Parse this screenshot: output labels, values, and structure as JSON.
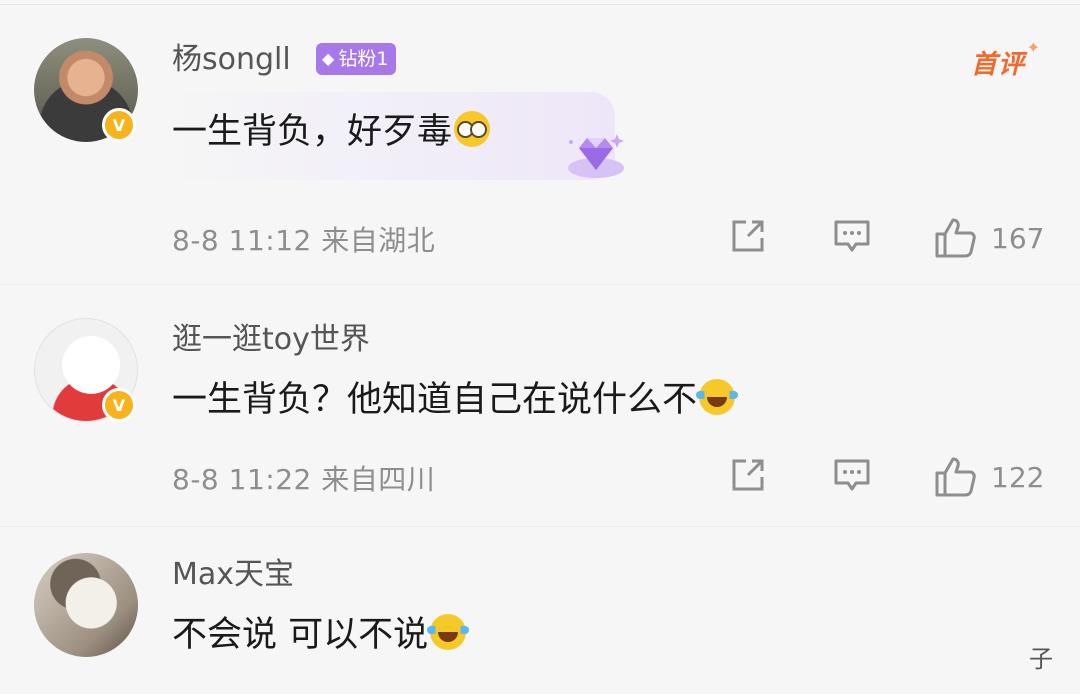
{
  "comments": [
    {
      "username": "杨songll",
      "fan_badge": "钻粉1",
      "first_tag": "首评",
      "text": "一生背负，好歹毒",
      "emoji": "glasses-emoji",
      "date": "8-8 11:12",
      "location": "来自湖北",
      "likes": "167",
      "verified": true
    },
    {
      "username": "逛一逛toy世界",
      "text": "一生背负？他知道自己在说什么不",
      "emoji": "laugh-cry-emoji",
      "date": "8-8 11:22",
      "location": "来自四川",
      "likes": "122",
      "verified": true
    },
    {
      "username": "Max天宝",
      "text": "不会说 可以不说",
      "emoji": "laugh-cry-emoji"
    }
  ],
  "verified_mark": "V",
  "watermark": "子",
  "colors": {
    "fan_badge": "#a678e8",
    "first_tag": "#f06a2a",
    "verified": "#f6b31b",
    "meta_gray": "#8e8e8e"
  }
}
